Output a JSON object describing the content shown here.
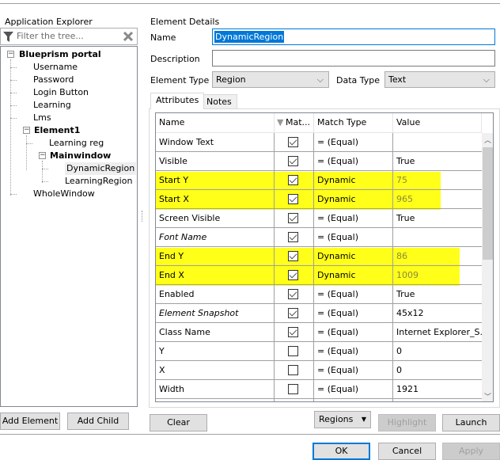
{
  "explorer": {
    "title": "Application Explorer",
    "filter_placeholder": "Filter the tree...",
    "tree": [
      {
        "label": "Blueprism portal",
        "bold": true
      },
      {
        "label": "Username"
      },
      {
        "label": "Password"
      },
      {
        "label": "Login Button"
      },
      {
        "label": "Learning"
      },
      {
        "label": "Lms"
      },
      {
        "label": "Element1",
        "bold": true
      },
      {
        "label": "Learning reg"
      },
      {
        "label": "Mainwindow",
        "bold": true
      },
      {
        "label": "DynamicRegion"
      },
      {
        "label": "LearningRegion"
      },
      {
        "label": "WholeWindow"
      }
    ],
    "add_element": "Add Element",
    "add_child": "Add Child"
  },
  "details": {
    "title": "Element Details",
    "name_label": "Name",
    "name_value": "DynamicRegion",
    "description_label": "Description",
    "description_value": "",
    "element_type_label": "Element Type",
    "element_type": "Region",
    "data_type_label": "Data Type",
    "data_type": "Text"
  },
  "tabs": [
    "Attributes",
    "Notes"
  ],
  "grid": {
    "headers": [
      "Name",
      "Mat...",
      "Match Type",
      "Value"
    ],
    "rows": [
      {
        "name": "Window Text",
        "match": true,
        "type": "=  (Equal)",
        "value": ""
      },
      {
        "name": "Visible",
        "match": true,
        "type": "=  (Equal)",
        "value": "True"
      },
      {
        "name": "Start Y",
        "match": true,
        "type": "Dynamic",
        "value": "75"
      },
      {
        "name": "Start X",
        "match": true,
        "type": "Dynamic",
        "value": "965"
      },
      {
        "name": "Screen Visible",
        "match": true,
        "type": "=  (Equal)",
        "value": "True"
      },
      {
        "name": "Font Name",
        "match": true,
        "type": "=  (Equal)",
        "value": ""
      },
      {
        "name": "End Y",
        "match": true,
        "type": "Dynamic",
        "value": "86"
      },
      {
        "name": "End X",
        "match": true,
        "type": "Dynamic",
        "value": "1009"
      },
      {
        "name": "Enabled",
        "match": true,
        "type": "=  (Equal)",
        "value": "True"
      },
      {
        "name": "Element Snapshot",
        "match": true,
        "type": "=  (Equal)",
        "value": "45x12"
      },
      {
        "name": "Class Name",
        "match": true,
        "type": "=  (Equal)",
        "value": "Internet Explorer_S..."
      },
      {
        "name": "Y",
        "match": false,
        "type": "=  (Equal)",
        "value": "0"
      },
      {
        "name": "X",
        "match": false,
        "type": "=  (Equal)",
        "value": "0"
      },
      {
        "name": "Width",
        "match": false,
        "type": "=  (Equal)",
        "value": "1921"
      }
    ]
  },
  "buttons": {
    "clear": "Clear",
    "regions": "Regions",
    "highlight": "Highlight",
    "launch": "Launch",
    "ok": "OK",
    "cancel": "Cancel",
    "apply": "Apply"
  },
  "colors": {
    "highlight": "#ffff00",
    "accent": "#0078d7"
  }
}
